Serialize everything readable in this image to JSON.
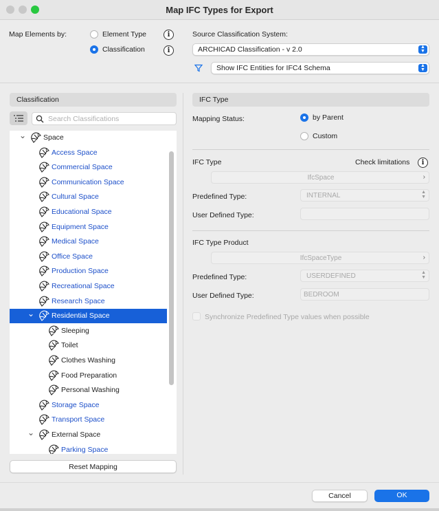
{
  "window": {
    "title": "Map IFC Types for Export",
    "traffic_colors": {
      "close": "#c8c8c8",
      "minimize": "#c8c8c8",
      "zoom": "#28c840"
    }
  },
  "map_by": {
    "label": "Map Elements by:",
    "options": [
      {
        "label": "Element Type",
        "selected": false
      },
      {
        "label": "Classification",
        "selected": true
      }
    ]
  },
  "source": {
    "label": "Source Classification System:",
    "system": "ARCHICAD Classification - v 2.0",
    "filter": "Show IFC Entities for IFC4 Schema"
  },
  "left": {
    "header": "Classification",
    "search_placeholder": "Search Classifications",
    "tree": [
      {
        "label": "Space",
        "level": 0,
        "chevron": "open",
        "style": "normal"
      },
      {
        "label": "Access Space",
        "level": 1,
        "style": "blue"
      },
      {
        "label": "Commercial Space",
        "level": 1,
        "style": "blue"
      },
      {
        "label": "Communication Space",
        "level": 1,
        "style": "blue"
      },
      {
        "label": "Cultural Space",
        "level": 1,
        "style": "blue"
      },
      {
        "label": "Educational Space",
        "level": 1,
        "style": "blue"
      },
      {
        "label": "Equipment Space",
        "level": 1,
        "style": "blue"
      },
      {
        "label": "Medical Space",
        "level": 1,
        "style": "blue"
      },
      {
        "label": "Office Space",
        "level": 1,
        "style": "blue"
      },
      {
        "label": "Production Space",
        "level": 1,
        "style": "blue"
      },
      {
        "label": "Recreational Space",
        "level": 1,
        "style": "blue"
      },
      {
        "label": "Research Space",
        "level": 1,
        "style": "blue"
      },
      {
        "label": "Residential Space",
        "level": 1,
        "chevron": "open",
        "style": "selected"
      },
      {
        "label": "Sleeping",
        "level": 2,
        "style": "normal"
      },
      {
        "label": "Toilet",
        "level": 2,
        "style": "normal"
      },
      {
        "label": "Clothes Washing",
        "level": 2,
        "style": "normal"
      },
      {
        "label": "Food Preparation",
        "level": 2,
        "style": "normal"
      },
      {
        "label": "Personal Washing",
        "level": 2,
        "style": "normal"
      },
      {
        "label": "Storage Space",
        "level": 1,
        "style": "blue"
      },
      {
        "label": "Transport Space",
        "level": 1,
        "style": "blue"
      },
      {
        "label": "External Space",
        "level": 1,
        "chevron": "open",
        "style": "normal"
      },
      {
        "label": "Parking Space",
        "level": 2,
        "style": "blue"
      }
    ],
    "reset_label": "Reset Mapping"
  },
  "right": {
    "header": "IFC Type",
    "mapping_status_label": "Mapping Status:",
    "status_options": [
      {
        "label": "by Parent",
        "selected": true
      },
      {
        "label": "Custom",
        "selected": false
      }
    ],
    "ifc_type_label": "IFC Type",
    "check_limitations": "Check limitations",
    "ifc_type_value": "IfcSpace",
    "predefined_type_label": "Predefined Type:",
    "predefined_type_value": "INTERNAL",
    "user_defined_label": "User Defined Type:",
    "user_defined_value": "",
    "product_label": "IFC Type Product",
    "product_value": "IfcSpaceType",
    "product_predefined_label": "Predefined Type:",
    "product_predefined_value": "USERDEFINED",
    "product_user_defined_label": "User Defined Type:",
    "product_user_defined_value": "BEDROOM",
    "sync_label": "Synchronize Predefined Type values when possible"
  },
  "footer": {
    "cancel": "Cancel",
    "ok": "OK",
    "accent": "#1a73e8"
  }
}
